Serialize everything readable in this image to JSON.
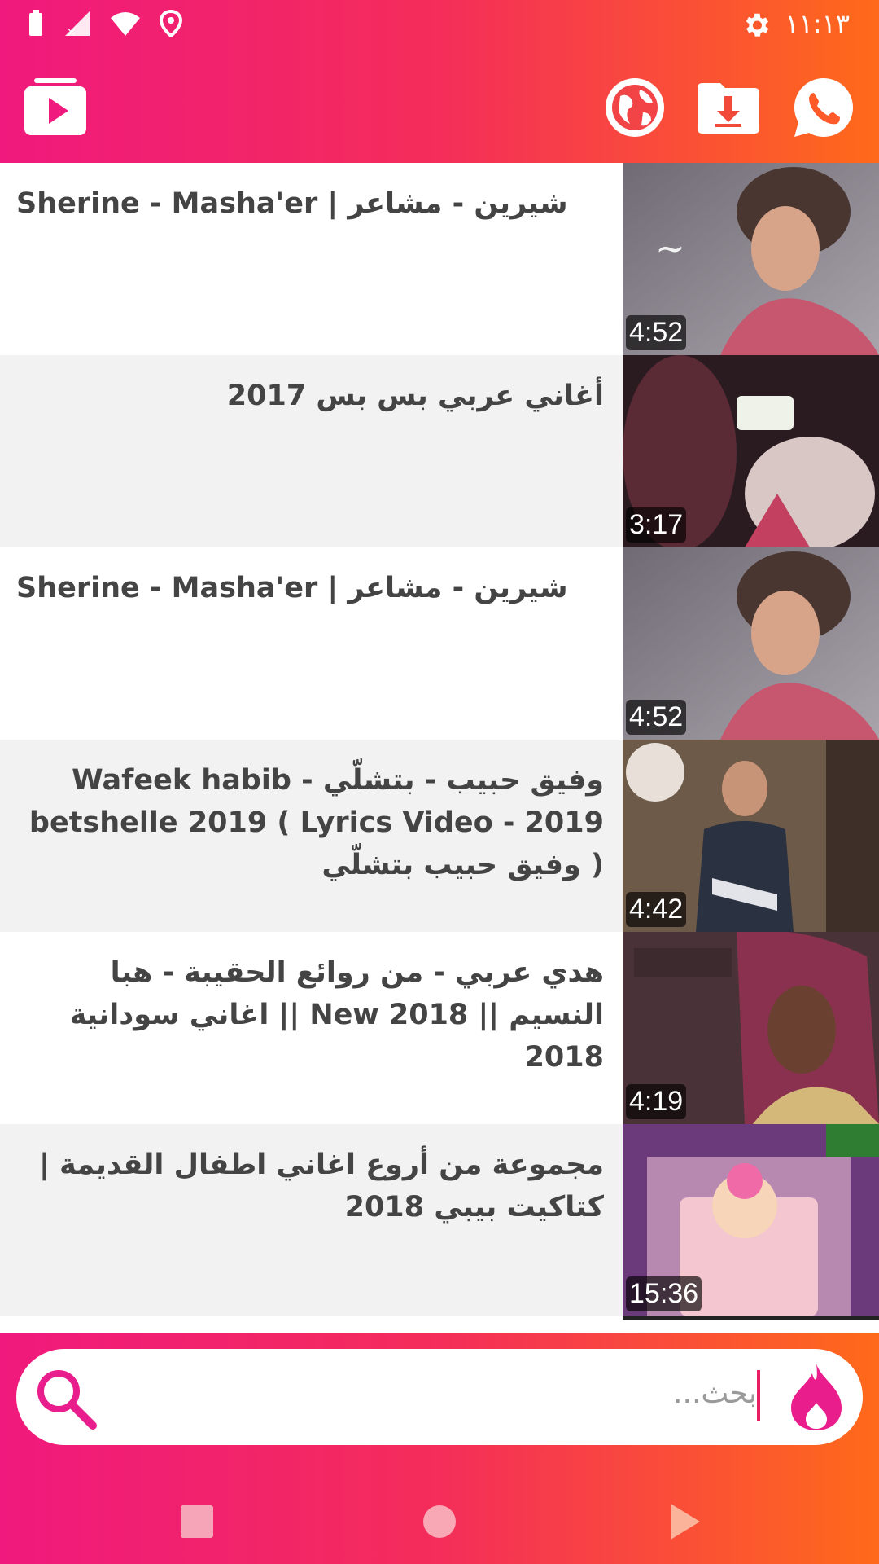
{
  "status_bar": {
    "time": "١١:١٣",
    "icons": [
      "battery-icon",
      "no-signal-icon",
      "wifi-icon",
      "location-icon",
      "settings-gear-icon"
    ]
  },
  "app_bar": {
    "logo_icon": "video-play-logo-icon",
    "actions": [
      "globe-icon",
      "download-folder-icon",
      "whatsapp-icon"
    ]
  },
  "videos": [
    {
      "title": "Sherine - Masha'er | شيرين - مشاعر",
      "duration": "4:52"
    },
    {
      "title": "أغاني عربي بس بس 2017",
      "duration": "3:17"
    },
    {
      "title": "Sherine - Masha'er | شيرين - مشاعر",
      "duration": "4:52"
    },
    {
      "title": "وفيق حبيب - بتشلّي - Wafeek habib betshelle 2019 ( Lyrics Video - 2019 ) وفيق حبيب بتشلّي",
      "duration": "4:42"
    },
    {
      "title": "هدي عربي - من روائع الحقيبة - هبا النسيم || New 2018 || اغاني سودانية 2018",
      "duration": "4:19"
    },
    {
      "title": "مجموعة من أروع اغاني اطفال القديمة | كتاكيت بيبي 2018",
      "duration": "15:36"
    }
  ],
  "search": {
    "placeholder": "بحث..."
  },
  "colors": {
    "gradient_start": "#f0197d",
    "gradient_end": "#ff6a1a",
    "accent": "#e91e63"
  }
}
